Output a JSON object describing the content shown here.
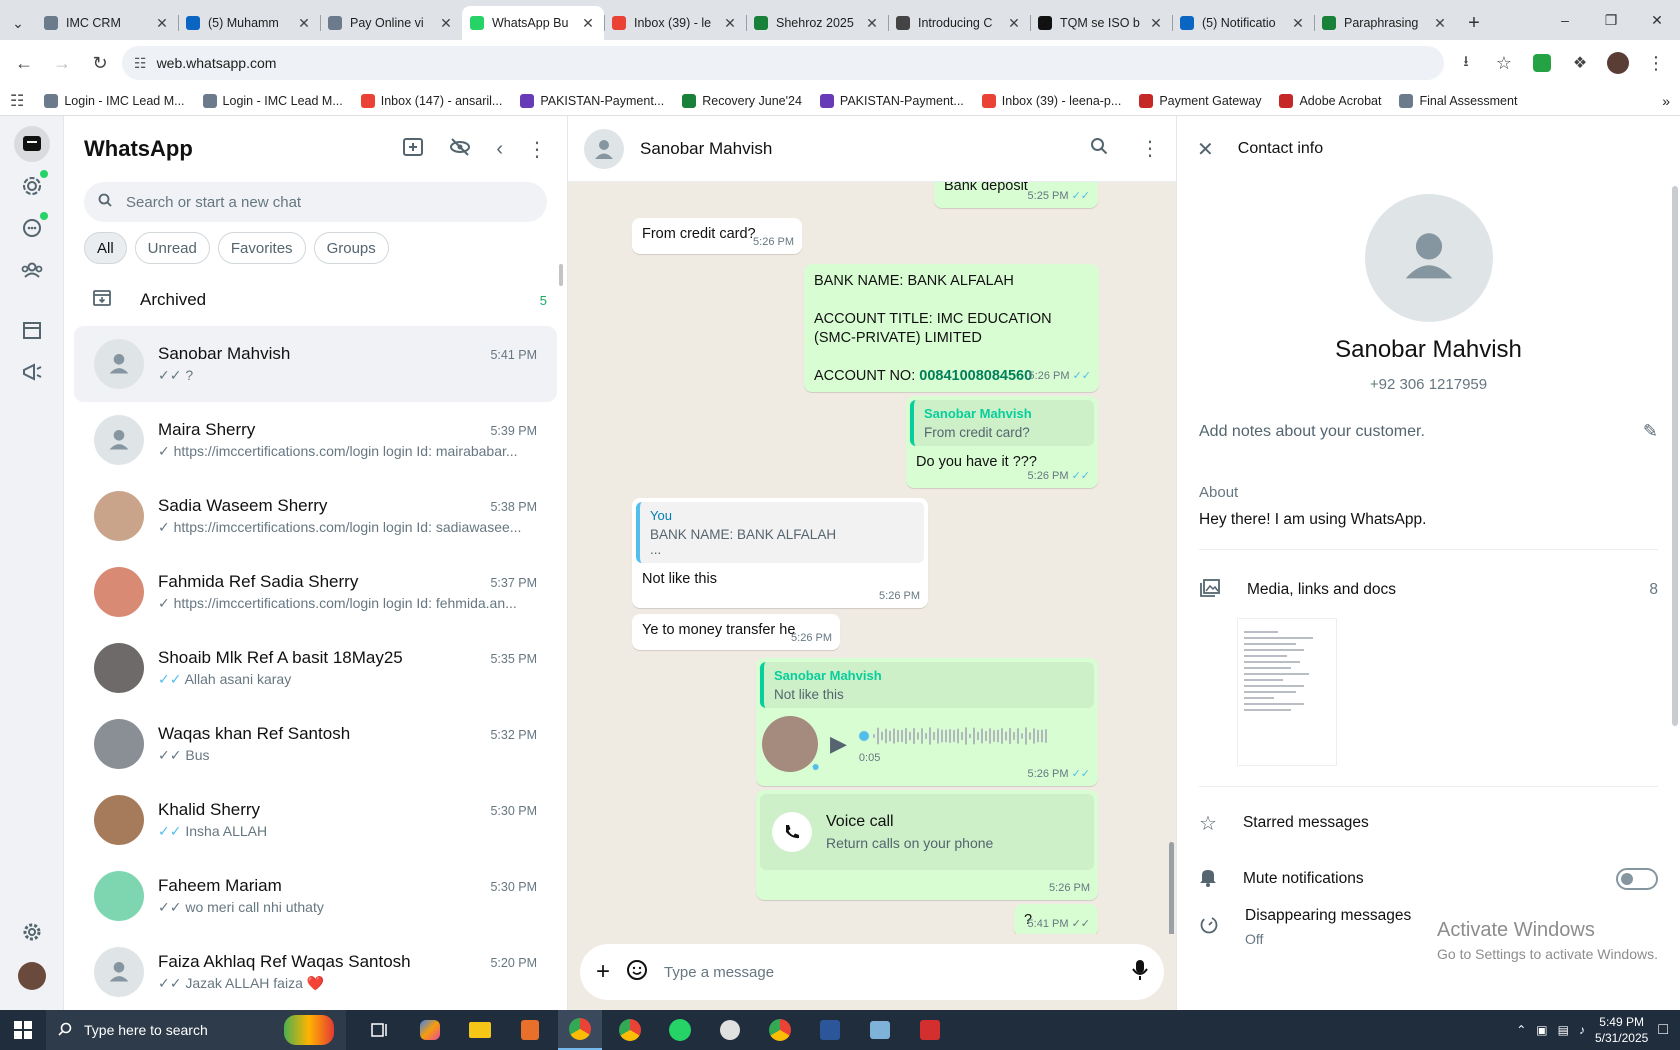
{
  "browser": {
    "tabs": [
      {
        "title": "IMC CRM",
        "color": "#6b7b8c"
      },
      {
        "title": "(5) Muhamm",
        "color": "#0a66c2"
      },
      {
        "title": "Pay Online vi",
        "color": "#6b7b8c"
      },
      {
        "title": "WhatsApp Bu",
        "color": "#25d366"
      },
      {
        "title": "Inbox (39) - le",
        "color": "#ea4335"
      },
      {
        "title": "Shehroz 2025",
        "color": "#188038"
      },
      {
        "title": "Introducing C",
        "color": "#444444"
      },
      {
        "title": "TQM se ISO b",
        "color": "#111111"
      },
      {
        "title": "(5) Notificatio",
        "color": "#0a66c2"
      },
      {
        "title": "Paraphrasing",
        "color": "#188038"
      }
    ],
    "active_tab": 3,
    "url": "web.whatsapp.com",
    "bookmarks": [
      {
        "label": "Login - IMC Lead M...",
        "color": "#6b7b8c"
      },
      {
        "label": "Login - IMC Lead M...",
        "color": "#6b7b8c"
      },
      {
        "label": "Inbox (147) - ansaril...",
        "color": "#ea4335"
      },
      {
        "label": "PAKISTAN-Payment...",
        "color": "#673ab7"
      },
      {
        "label": "Recovery June'24",
        "color": "#188038"
      },
      {
        "label": "PAKISTAN-Payment...",
        "color": "#673ab7"
      },
      {
        "label": "Inbox (39) - leena-p...",
        "color": "#ea4335"
      },
      {
        "label": "Payment Gateway",
        "color": "#c62828"
      },
      {
        "label": "Adobe Acrobat",
        "color": "#c62828"
      },
      {
        "label": "Final Assessment",
        "color": "#6b7b8c"
      }
    ]
  },
  "sidebar": {
    "title": "WhatsApp",
    "search_placeholder": "Search or start a new chat",
    "filters": [
      "All",
      "Unread",
      "Favorites",
      "Groups"
    ],
    "archived_label": "Archived",
    "archived_count": "5",
    "chats": [
      {
        "name": "Sanobar Mahvish",
        "time": "5:41 PM",
        "msg": "?",
        "tick": "grey",
        "avatar": "default"
      },
      {
        "name": "Maira Sherry",
        "time": "5:39 PM",
        "msg": "https://imccertifications.com/login login Id: mairababar...",
        "tick": "single",
        "avatar": "default"
      },
      {
        "name": "Sadia Waseem Sherry",
        "time": "5:38 PM",
        "msg": "https://imccertifications.com/login login Id: sadiawasee...",
        "tick": "single",
        "avatar": "#c9a48a"
      },
      {
        "name": "Fahmida Ref Sadia Sherry",
        "time": "5:37 PM",
        "msg": "https://imccertifications.com/login login Id: fehmida.an...",
        "tick": "single",
        "avatar": "#d98a74"
      },
      {
        "name": "Shoaib Mlk Ref A basit 18May25",
        "time": "5:35 PM",
        "msg": "Allah asani karay",
        "tick": "blue",
        "avatar": "#6e6a6a"
      },
      {
        "name": "Waqas khan Ref Santosh",
        "time": "5:32 PM",
        "msg": "Bus",
        "tick": "grey",
        "avatar": "#8a8f96"
      },
      {
        "name": "Khalid Sherry",
        "time": "5:30 PM",
        "msg": "Insha ALLAH",
        "tick": "blue",
        "avatar": "#a67b5b"
      },
      {
        "name": "Faheem Mariam",
        "time": "5:30 PM",
        "msg": "wo meri call nhi uthaty",
        "tick": "grey",
        "avatar": "#7ed6b0"
      },
      {
        "name": "Faiza Akhlaq Ref Waqas Santosh",
        "time": "5:20 PM",
        "msg": "Jazak ALLAH faiza ❤️",
        "tick": "grey",
        "avatar": "default"
      }
    ]
  },
  "conversation": {
    "contact_name": "Sanobar Mahvish",
    "messages": {
      "m1": {
        "text": "Bank deposit",
        "time": "5:25 PM"
      },
      "m2": {
        "text": "From credit card?",
        "time": "5:26 PM"
      },
      "m3": {
        "line1": "BANK NAME: BANK ALFALAH",
        "line2": "ACCOUNT TITLE: IMC EDUCATION (SMC-PRIVATE) LIMITED",
        "line3_label": "ACCOUNT NO: ",
        "line3_value": "00841008084560",
        "time": "5:26 PM"
      },
      "m4": {
        "quote_name": "Sanobar Mahvish",
        "quote_text": "From credit card?",
        "text": "Do you have it ???",
        "time": "5:26 PM"
      },
      "m5": {
        "quote_name": "You",
        "quote_text1": "BANK NAME: BANK ALFALAH",
        "quote_text2": "...",
        "text": "Not like this",
        "time": "5:26 PM"
      },
      "m6": {
        "text": "Ye to money transfer he",
        "time": "5:26 PM"
      },
      "m7": {
        "quote_name": "Sanobar Mahvish",
        "quote_text": "Not like this",
        "duration": "0:05",
        "time": "5:26 PM"
      },
      "m8": {
        "title": "Voice call",
        "subtitle": "Return calls on your phone",
        "time": "5:26 PM"
      },
      "m9": {
        "text": "?",
        "time": "5:41 PM"
      }
    },
    "composer_placeholder": "Type a message"
  },
  "contact_info": {
    "header": "Contact info",
    "name": "Sanobar Mahvish",
    "phone": "+92 306 1217959",
    "notes_placeholder": "Add notes about your customer.",
    "about_label": "About",
    "about_value": "Hey there! I am using WhatsApp.",
    "media_label": "Media, links and docs",
    "media_count": "8",
    "starred_label": "Starred messages",
    "mute_label": "Mute notifications",
    "disappearing_label": "Disappearing messages",
    "disappearing_value": "Off"
  },
  "watermark": {
    "line1": "Activate Windows",
    "line2": "Go to Settings to activate Windows."
  },
  "taskbar": {
    "search_placeholder": "Type here to search",
    "time": "5:49 PM",
    "date": "5/31/2025"
  }
}
